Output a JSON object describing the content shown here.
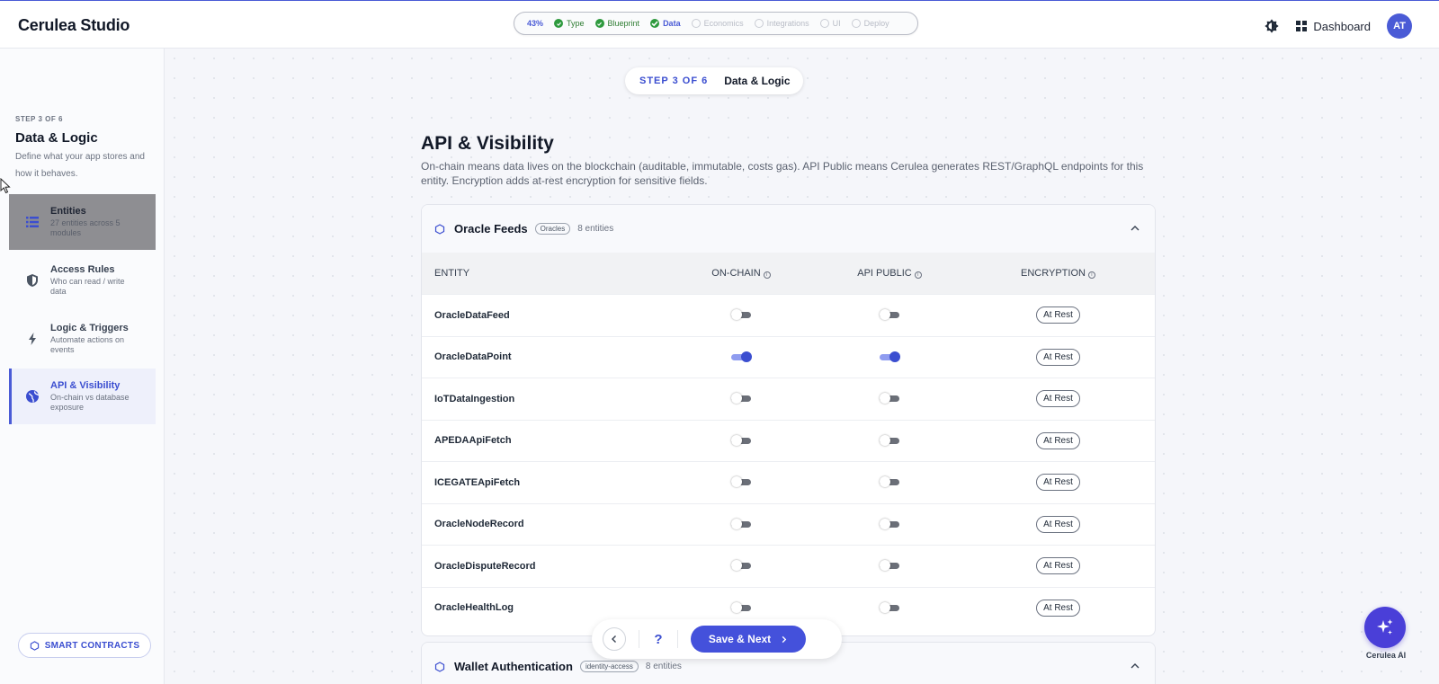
{
  "app": {
    "title": "Cerulea Studio"
  },
  "progress": {
    "percent": "43%",
    "steps": [
      {
        "label": "Type",
        "state": "done"
      },
      {
        "label": "Blueprint",
        "state": "done"
      },
      {
        "label": "Data",
        "state": "active"
      },
      {
        "label": "Economics",
        "state": "pending"
      },
      {
        "label": "Integrations",
        "state": "pending"
      },
      {
        "label": "UI",
        "state": "pending"
      },
      {
        "label": "Deploy",
        "state": "pending"
      }
    ]
  },
  "header": {
    "dashboard_label": "Dashboard",
    "avatar_initials": "AT",
    "theme_icon": "brightness-icon",
    "dashboard_icon": "grid-icon"
  },
  "sidebar": {
    "step": "STEP 3 OF 6",
    "title": "Data & Logic",
    "description": "Define what your app stores and how it behaves.",
    "items": [
      {
        "label": "Entities",
        "sub": "27 entities across 5 modules",
        "icon": "list-icon",
        "state": "hovered"
      },
      {
        "label": "Access Rules",
        "sub": "Who can read / write data",
        "icon": "shield-icon",
        "state": "normal"
      },
      {
        "label": "Logic & Triggers",
        "sub": "Automate actions on events",
        "icon": "bolt-icon",
        "state": "normal"
      },
      {
        "label": "API & Visibility",
        "sub": "On-chain vs database exposure",
        "icon": "globe-icon",
        "state": "active"
      }
    ],
    "smart_contracts_label": "SMART CONTRACTS"
  },
  "main": {
    "step_pill": {
      "step": "STEP 3 OF 6",
      "name": "Data & Logic"
    },
    "title": "API & Visibility",
    "description": "On-chain means data lives on the blockchain (auditable, immutable, costs gas). API Public means Cerulea generates REST/GraphQL endpoints for this entity. Encryption adds at-rest encryption for sensitive fields.",
    "columns": {
      "entity": "ENTITY",
      "on_chain": "ON-CHAIN",
      "api_public": "API PUBLIC",
      "encryption": "ENCRYPTION"
    },
    "groups": [
      {
        "name": "Oracle Feeds",
        "tag": "Oracles",
        "count": "8 entities",
        "rows": [
          {
            "entity": "OracleDataFeed",
            "on_chain": false,
            "api_public": false,
            "encryption": "At Rest"
          },
          {
            "entity": "OracleDataPoint",
            "on_chain": true,
            "api_public": true,
            "encryption": "At Rest"
          },
          {
            "entity": "IoTDataIngestion",
            "on_chain": false,
            "api_public": false,
            "encryption": "At Rest"
          },
          {
            "entity": "APEDAApiFetch",
            "on_chain": false,
            "api_public": false,
            "encryption": "At Rest"
          },
          {
            "entity": "ICEGATEApiFetch",
            "on_chain": false,
            "api_public": false,
            "encryption": "At Rest"
          },
          {
            "entity": "OracleNodeRecord",
            "on_chain": false,
            "api_public": false,
            "encryption": "At Rest"
          },
          {
            "entity": "OracleDisputeRecord",
            "on_chain": false,
            "api_public": false,
            "encryption": "At Rest"
          },
          {
            "entity": "OracleHealthLog",
            "on_chain": false,
            "api_public": false,
            "encryption": "At Rest"
          }
        ]
      },
      {
        "name": "Wallet Authentication",
        "tag": "identity-access",
        "count": "8 entities",
        "rows": []
      }
    ]
  },
  "bottom_bar": {
    "help": "?",
    "save_label": "Save & Next"
  },
  "assistant": {
    "label": "Cerulea AI"
  },
  "colors": {
    "accent": "#4a5bd6",
    "success": "#2e9a3e"
  }
}
